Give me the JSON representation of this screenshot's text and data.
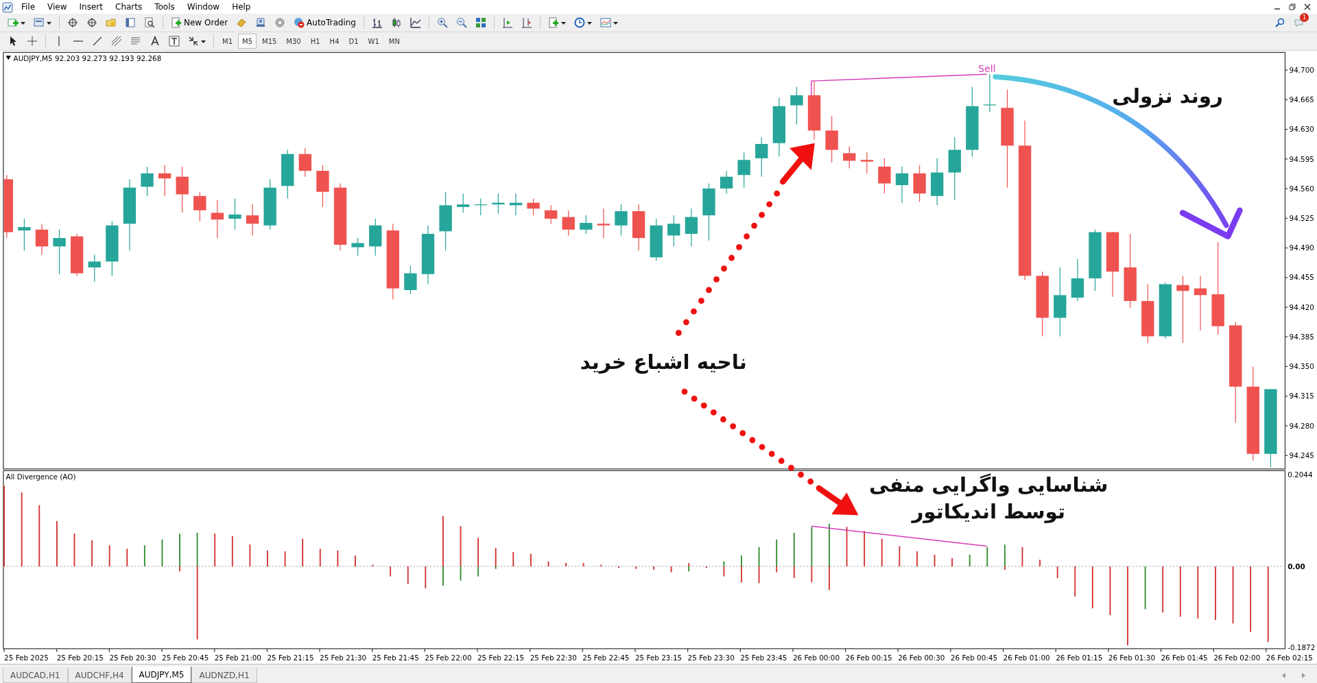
{
  "menu": [
    "File",
    "View",
    "Insert",
    "Charts",
    "Tools",
    "Window",
    "Help"
  ],
  "toolbar": {
    "buttons": [
      "New Order",
      "AutoTrading"
    ]
  },
  "timeframes": [
    {
      "label": "M1",
      "selected": false
    },
    {
      "label": "M5",
      "selected": true
    },
    {
      "label": "M15",
      "selected": false
    },
    {
      "label": "M30",
      "selected": false
    },
    {
      "label": "H1",
      "selected": false
    },
    {
      "label": "H4",
      "selected": false
    },
    {
      "label": "D1",
      "selected": false
    },
    {
      "label": "W1",
      "selected": false
    },
    {
      "label": "MN",
      "selected": false
    }
  ],
  "notifications": {
    "count": "1"
  },
  "chart": {
    "header": "AUDJPY,M5  92.203 92.273 92.193 92.268",
    "price_axis": [
      "94.700",
      "94.665",
      "94.630",
      "94.595",
      "94.560",
      "94.525",
      "94.490",
      "94.455",
      "94.420",
      "94.385",
      "94.350",
      "94.315",
      "94.280",
      "94.245"
    ],
    "signal_label": "Sell",
    "indicator": {
      "title": "All Divergence (AO)",
      "axis": [
        "0.2044",
        "0.00",
        "-0.1872"
      ]
    },
    "time_axis": [
      "25 Feb 2025",
      "25 Feb 20:15",
      "25 Feb 20:30",
      "25 Feb 20:45",
      "25 Feb 21:00",
      "25 Feb 21:15",
      "25 Feb 21:30",
      "25 Feb 21:45",
      "25 Feb 22:00",
      "25 Feb 22:15",
      "25 Feb 22:30",
      "25 Feb 22:45",
      "25 Feb 23:15",
      "25 Feb 23:30",
      "25 Feb 23:45",
      "26 Feb 00:00",
      "26 Feb 00:15",
      "26 Feb 00:30",
      "26 Feb 00:45",
      "26 Feb 01:00",
      "26 Feb 01:15",
      "26 Feb 01:30",
      "26 Feb 01:45",
      "26 Feb 02:00",
      "26 Feb 02:15"
    ],
    "annotations": {
      "downtrend": "روند نزولی",
      "overbought": "ناحیه اشباع خرید",
      "divergence": [
        "شناسایی واگرایی منفی",
        "توسط اندیکاتور"
      ]
    }
  },
  "tabs": [
    {
      "label": "AUDCAD,H1",
      "selected": false
    },
    {
      "label": "AUDCHF,H4",
      "selected": false
    },
    {
      "label": "AUDJPY,M5",
      "selected": true
    },
    {
      "label": "AUDNZD,H1",
      "selected": false
    }
  ]
}
